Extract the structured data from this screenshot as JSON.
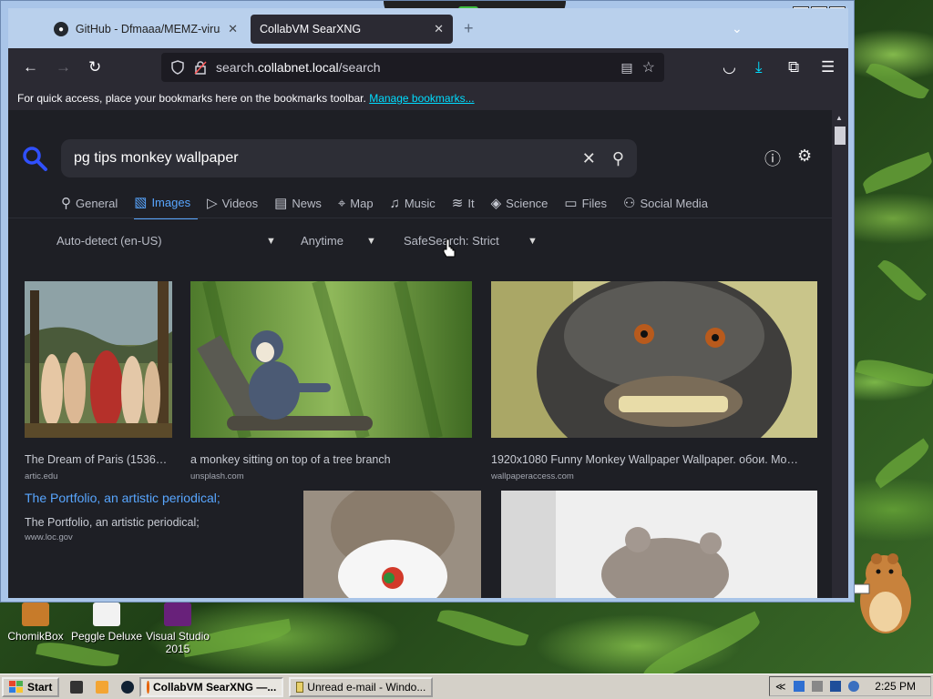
{
  "browser": {
    "tabs": [
      {
        "label": "GitHub - Dfmaaa/MEMZ-virus:",
        "active": false
      },
      {
        "label": "CollabVM SearXNG",
        "active": true
      }
    ],
    "url_prefix": "search.",
    "url_host": "collabnet.local",
    "url_path": "/search",
    "bookmarks_text": "For quick access, place your bookmarks here on the bookmarks toolbar.",
    "bookmarks_link": "Manage bookmarks..."
  },
  "search": {
    "query": "pg tips monkey wallpaper"
  },
  "categories": [
    {
      "label": "General",
      "icon": "search-icon"
    },
    {
      "label": "Images",
      "icon": "image-icon"
    },
    {
      "label": "Videos",
      "icon": "play-icon"
    },
    {
      "label": "News",
      "icon": "newspaper-icon"
    },
    {
      "label": "Map",
      "icon": "map-pin-icon"
    },
    {
      "label": "Music",
      "icon": "music-icon"
    },
    {
      "label": "It",
      "icon": "layers-icon"
    },
    {
      "label": "Science",
      "icon": "science-icon"
    },
    {
      "label": "Files",
      "icon": "files-icon"
    },
    {
      "label": "Social Media",
      "icon": "people-icon"
    }
  ],
  "filters": {
    "language": "Auto-detect (en-US)",
    "time": "Anytime",
    "safesearch": "SafeSearch: Strict"
  },
  "results": [
    {
      "title": "The Dream of Paris (1536…",
      "url": "artic.edu"
    },
    {
      "title": "a monkey sitting on top of a tree branch",
      "url": "unsplash.com"
    },
    {
      "title": "1920x1080 Funny Monkey Wallpaper Wallpaper. обои. Mo…",
      "url": "wallpaperaccess.com"
    },
    {
      "title": "The Portfolio, an artistic periodical;",
      "subtitle": "The Portfolio, an artistic periodical;",
      "url": "www.loc.gov"
    }
  ],
  "desktop_icons": [
    {
      "label": "ChomikBox"
    },
    {
      "label": "Peggle Deluxe"
    },
    {
      "label": "Visual Studio 2015"
    }
  ],
  "taskbar": {
    "start": "Start",
    "tasks": [
      {
        "label": "CollabVM SearXNG —...",
        "active": true
      },
      {
        "label": "Unread e-mail - Windo...",
        "active": false
      }
    ],
    "clock": "2:25 PM"
  },
  "colors": {
    "accent": "#58a6ff",
    "page_bg": "#1e1f25",
    "browser_bg": "#2b2a33"
  }
}
